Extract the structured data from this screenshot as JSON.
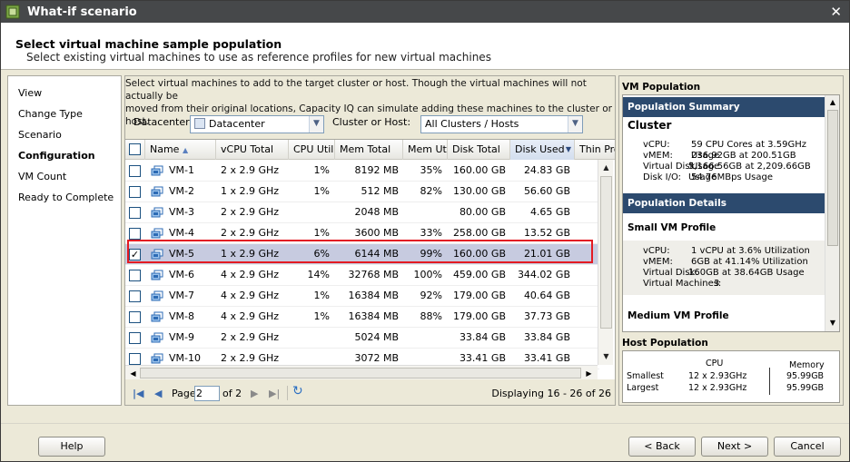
{
  "window": {
    "title": "What-if scenario",
    "close_label": "✕"
  },
  "header": {
    "title": "Select virtual machine sample population",
    "subtitle": "Select existing virtual machines to use as reference profiles for new virtual machines"
  },
  "nav": {
    "items": [
      {
        "label": "View"
      },
      {
        "label": "Change Type"
      },
      {
        "label": "Scenario"
      },
      {
        "label": "Configuration"
      },
      {
        "label": "VM Count"
      },
      {
        "label": "Ready to Complete"
      }
    ],
    "active": "Configuration"
  },
  "intro": {
    "line1": "Select virtual machines to add to the target cluster or host. Though the virtual machines will not actually be",
    "line2": "moved from their original locations, Capacity IQ can simulate adding these machines to the cluster or host."
  },
  "filters": {
    "datacenter_label": "Datacenter:",
    "datacenter_value": "Datacenter",
    "cluster_label": "Cluster or Host:",
    "cluster_value": "All Clusters / Hosts"
  },
  "table": {
    "columns": [
      "Name",
      "vCPU Total",
      "CPU Util",
      "Mem Total",
      "Mem Util",
      "Disk Total",
      "Disk Used",
      "Thin Pro"
    ],
    "sort_indicator": "▲",
    "rows": [
      {
        "checked": false,
        "name": "VM-1",
        "vcpu": "2 x 2.9 GHz",
        "cpu_util": "1%",
        "mem_total": "8192 MB",
        "mem_util": "35%",
        "disk_total": "160.00 GB",
        "disk_used": "24.83 GB"
      },
      {
        "checked": false,
        "name": "VM-2",
        "vcpu": "1 x 2.9 GHz",
        "cpu_util": "1%",
        "mem_total": "512 MB",
        "mem_util": "82%",
        "disk_total": "130.00 GB",
        "disk_used": "56.60 GB"
      },
      {
        "checked": false,
        "name": "VM-3",
        "vcpu": "2 x 2.9 GHz",
        "cpu_util": "",
        "mem_total": "2048 MB",
        "mem_util": "",
        "disk_total": "80.00 GB",
        "disk_used": "4.65 GB"
      },
      {
        "checked": false,
        "name": "VM-4",
        "vcpu": "2 x 2.9 GHz",
        "cpu_util": "1%",
        "mem_total": "3600 MB",
        "mem_util": "33%",
        "disk_total": "258.00 GB",
        "disk_used": "13.52 GB"
      },
      {
        "checked": true,
        "name": "VM-5",
        "vcpu": "1 x 2.9 GHz",
        "cpu_util": "6%",
        "mem_total": "6144 MB",
        "mem_util": "99%",
        "disk_total": "160.00 GB",
        "disk_used": "21.01 GB"
      },
      {
        "checked": false,
        "name": "VM-6",
        "vcpu": "4 x 2.9 GHz",
        "cpu_util": "14%",
        "mem_total": "32768 MB",
        "mem_util": "100%",
        "disk_total": "459.00 GB",
        "disk_used": "344.02 GB"
      },
      {
        "checked": false,
        "name": "VM-7",
        "vcpu": "4 x 2.9 GHz",
        "cpu_util": "1%",
        "mem_total": "16384 MB",
        "mem_util": "92%",
        "disk_total": "179.00 GB",
        "disk_used": "40.64 GB"
      },
      {
        "checked": false,
        "name": "VM-8",
        "vcpu": "4 x 2.9 GHz",
        "cpu_util": "1%",
        "mem_total": "16384 MB",
        "mem_util": "88%",
        "disk_total": "179.00 GB",
        "disk_used": "37.73 GB"
      },
      {
        "checked": false,
        "name": "VM-9",
        "vcpu": "2 x 2.9 GHz",
        "cpu_util": "",
        "mem_total": "5024 MB",
        "mem_util": "",
        "disk_total": "33.84 GB",
        "disk_used": "33.84 GB"
      },
      {
        "checked": false,
        "name": "VM-10",
        "vcpu": "2 x 2.9 GHz",
        "cpu_util": "",
        "mem_total": "3072 MB",
        "mem_util": "",
        "disk_total": "33.41 GB",
        "disk_used": "33.41 GB"
      }
    ]
  },
  "pager": {
    "page_label": "Page",
    "page_value": "2",
    "of_label": "of 2",
    "display_text": "Displaying 16 - 26 of 26"
  },
  "vm_population": {
    "title": "VM Population",
    "summary_title": "Population Summary",
    "cluster_title": "Cluster",
    "cluster_rows": [
      {
        "label": "vCPU:",
        "value": "59 CPU Cores at 3.59GHz Usage"
      },
      {
        "label": "vMEM:",
        "value": "236.92GB at 200.51GB Usage"
      },
      {
        "label": "Virtual Disk:",
        "value": "5,166.56GB at 2,209.66GB Usage"
      },
      {
        "label": "Disk I/O:",
        "value": "54.76MBps Usage"
      }
    ],
    "details_title": "Population Details",
    "small_title": "Small VM Profile",
    "small_rows": [
      {
        "label": "vCPU:",
        "value": "1 vCPU at 3.6% Utilization"
      },
      {
        "label": "vMEM:",
        "value": "6GB at 41.14% Utilization"
      },
      {
        "label": "Virtual Disk:",
        "value": "160GB at 38.64GB Usage"
      },
      {
        "label": "Virtual Machines:",
        "value": "3"
      }
    ],
    "medium_title": "Medium VM Profile"
  },
  "host_population": {
    "title": "Host Population",
    "cpu_header": "CPU",
    "memory_header": "Memory",
    "rows": [
      {
        "label": "Smallest",
        "cpu": "12 x 2.93GHz",
        "memory": "95.99GB"
      },
      {
        "label": "Largest",
        "cpu": "12 x 2.93GHz",
        "memory": "95.99GB"
      }
    ]
  },
  "footer": {
    "help": "Help",
    "back": "< Back",
    "next": "Next >",
    "cancel": "Cancel"
  },
  "colors": {
    "titlebar": "#46484a",
    "section_bar": "#2c4a6e",
    "selected_row": "#c7cbe0",
    "highlight_box": "#e31b23"
  }
}
